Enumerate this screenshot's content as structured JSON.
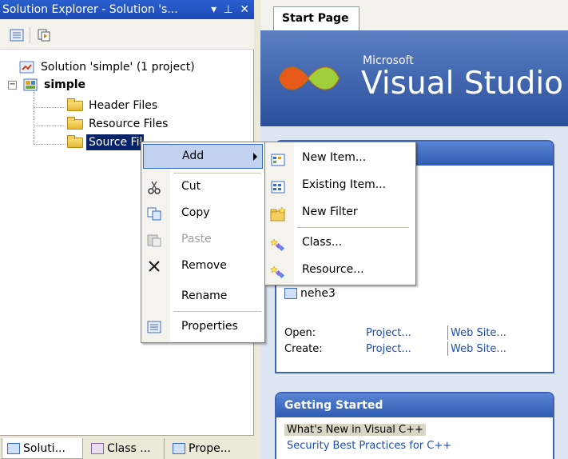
{
  "solution_explorer": {
    "title": "Solution Explorer - Solution 's...",
    "title_controls": "▾ ⊥ ✕",
    "tree": {
      "solution_label": "Solution 'simple' (1 project)",
      "expander": "−",
      "project_label": "simple",
      "folders": [
        "Header Files",
        "Resource Files",
        "Source Files"
      ]
    },
    "bottom_tabs": [
      "Soluti...",
      "Class ...",
      "Prope..."
    ]
  },
  "start_page": {
    "tab_label": "Start Page",
    "banner_brand": "Microsoft",
    "banner_product": "Visual Studio",
    "recent_item": "nehe3",
    "open_label": "Open:",
    "create_label": "Create:",
    "project_link": "Project...",
    "website_link": "Web Site...",
    "getting_started_title": "Getting Started",
    "getting_started_items": [
      "What's New in Visual C++",
      "Security Best Practices for C++"
    ]
  },
  "context_menu": {
    "items": [
      {
        "label": "Add",
        "icon": "none",
        "has_submenu": true,
        "selected": true,
        "disabled": false
      },
      {
        "label": "Cut",
        "icon": "scissors-icon",
        "disabled": false
      },
      {
        "label": "Copy",
        "icon": "copy-icon",
        "disabled": false
      },
      {
        "label": "Paste",
        "icon": "paste-icon",
        "disabled": true
      },
      {
        "label": "Remove",
        "icon": "remove-x-icon",
        "disabled": false
      },
      {
        "label": "Rename",
        "icon": "none",
        "disabled": false
      },
      {
        "label": "Properties",
        "icon": "properties-icon",
        "disabled": false
      }
    ]
  },
  "submenu": {
    "items": [
      {
        "label": "New Item...",
        "icon": "new-item-icon"
      },
      {
        "label": "Existing Item...",
        "icon": "existing-item-icon"
      },
      {
        "label": "New Filter",
        "icon": "new-filter-folder-icon"
      },
      {
        "label": "Class...",
        "icon": "class-icon"
      },
      {
        "label": "Resource...",
        "icon": "resource-icon"
      }
    ]
  },
  "colors": {
    "title_bar": "#1d4ab5",
    "selection": "#0a246a",
    "menu_highlight": "#c1d2ee",
    "link": "#1f4db3"
  }
}
